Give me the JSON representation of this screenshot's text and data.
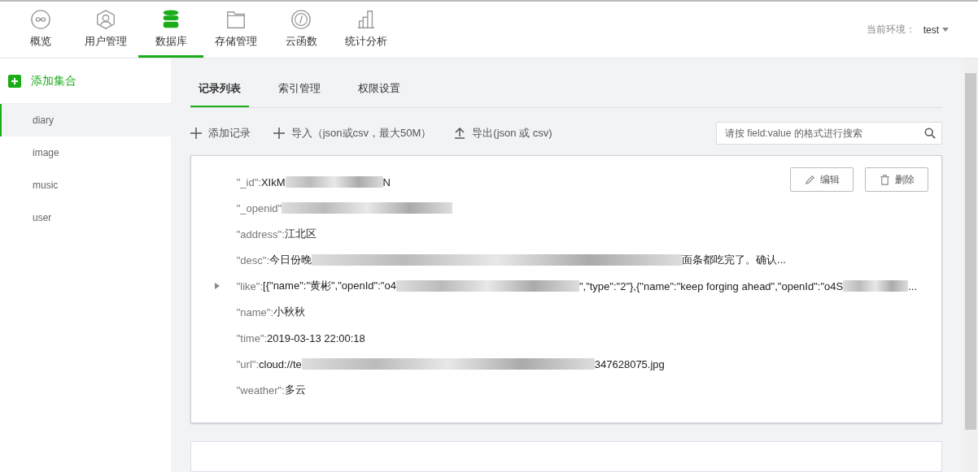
{
  "nav": {
    "tabs": [
      {
        "label": "概览",
        "selected": false
      },
      {
        "label": "用户管理",
        "selected": false
      },
      {
        "label": "数据库",
        "selected": true
      },
      {
        "label": "存储管理",
        "selected": false
      },
      {
        "label": "云函数",
        "selected": false
      },
      {
        "label": "统计分析",
        "selected": false
      }
    ],
    "env_label": "当前环境：",
    "env_value": "test"
  },
  "sidebar": {
    "add_label": "添加集合",
    "items": [
      {
        "label": "diary",
        "selected": true
      },
      {
        "label": "image",
        "selected": false
      },
      {
        "label": "music",
        "selected": false
      },
      {
        "label": "user",
        "selected": false
      }
    ]
  },
  "tabs": [
    {
      "label": "记录列表",
      "selected": true
    },
    {
      "label": "索引管理",
      "selected": false
    },
    {
      "label": "权限设置",
      "selected": false
    }
  ],
  "toolbar": {
    "actions": [
      {
        "label": "添加记录"
      },
      {
        "label": "导入（json或csv，最大50M）"
      },
      {
        "label": "导出(json 或 csv)"
      }
    ],
    "search_placeholder": "请按 field:value 的格式进行搜索"
  },
  "record": {
    "edit": "编辑",
    "delete": "删除",
    "fields": [
      {
        "key": "\"_id\":",
        "expandable": false,
        "parts": [
          {
            "kind": "text",
            "text": "XIkM"
          },
          {
            "kind": "redacted"
          },
          {
            "kind": "text",
            "text": "N"
          }
        ]
      },
      {
        "key": "\"_openid\"",
        "expandable": false,
        "parts": [
          {
            "kind": "redacted"
          }
        ]
      },
      {
        "key": "\"address\":",
        "expandable": false,
        "parts": [
          {
            "kind": "text",
            "text": "江北区"
          }
        ]
      },
      {
        "key": "\"desc\":",
        "expandable": false,
        "parts": [
          {
            "kind": "text",
            "text": "今日份晚"
          },
          {
            "kind": "redacted"
          },
          {
            "kind": "text",
            "text": "面条都吃完了。确认..."
          }
        ]
      },
      {
        "key": "\"like\":",
        "expandable": true,
        "parts": [
          {
            "kind": "text",
            "text": "[{\"name\":\"黄彬\",\"openId\":\"o4"
          },
          {
            "kind": "redacted"
          },
          {
            "kind": "text",
            "text": "\",\"type\":\"2\"},{\"name\":\"keep forging ahead\",\"openId\":\"o4S"
          },
          {
            "kind": "redacted"
          },
          {
            "kind": "text",
            "text": "..."
          }
        ]
      },
      {
        "key": "\"name\":",
        "expandable": false,
        "parts": [
          {
            "kind": "text",
            "text": "小秋秋"
          }
        ]
      },
      {
        "key": "\"time\":",
        "expandable": false,
        "parts": [
          {
            "kind": "text",
            "text": "2019-03-13 22:00:18"
          }
        ]
      },
      {
        "key": "\"url\":",
        "expandable": false,
        "parts": [
          {
            "kind": "text",
            "text": "cloud://te"
          },
          {
            "kind": "redacted"
          },
          {
            "kind": "text",
            "text": "347628075.jpg"
          }
        ]
      },
      {
        "key": "\"weather\":",
        "expandable": false,
        "parts": [
          {
            "kind": "text",
            "text": "多云"
          }
        ]
      }
    ]
  }
}
